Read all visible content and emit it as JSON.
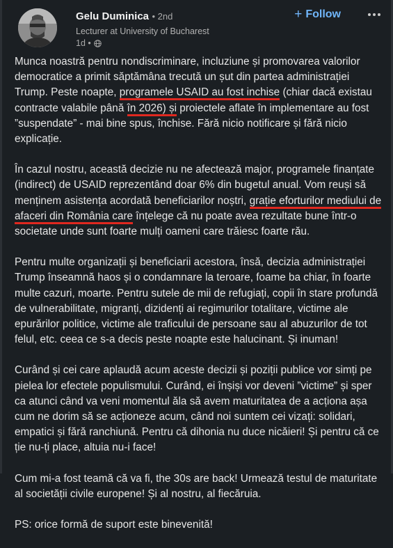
{
  "author": {
    "name": "Gelu Duminica",
    "degree": "• 2nd",
    "headline": "Lecturer at University of Bucharest",
    "time": "1d •"
  },
  "actions": {
    "follow_label": "Follow",
    "follow_plus": "+"
  },
  "colors": {
    "background": "#1b1f23",
    "accent": "#70b5f9",
    "underline": "#e0281f"
  },
  "icons": {
    "visibility": "globe-icon",
    "more": "more-dots-icon"
  },
  "post": {
    "p1": {
      "a": "Munca noastră pentru nondiscriminare, incluziune și promovarea valorilor democratice a primit săptămâna trecută un șut din partea administrației Trump. Peste noapte, ",
      "u1": "programele USAID au fost inchise",
      "b": " (chiar dacă existau contracte valabile până ",
      "u2": "în 2026) și",
      "c": " proiectele aflate în implementare au fost ”suspendate” - mai bine spus, închise. Fără nicio notificare și fără nicio explicație."
    },
    "p2": {
      "a": "În cazul nostru, această decizie nu ne afectează major, programele finanțate (indirect) de USAID reprezentând doar 6% din bugetul anual. Vom reuși să menținem asistența acordată beneficiarilor noștri, ",
      "u1": "grație eforturilor mediului de afaceri din România care",
      "b": " înțelege că nu poate avea rezultate bune într-o societate unde sunt foarte mulți oameni care trăiesc foarte rău."
    },
    "p3": "Pentru multe organizații și beneficiarii acestora, însă, decizia administrației Trump înseamnă haos și o condamnare la teroare, foame ba chiar, în foarte multe cazuri, moarte. Pentru sutele de mii de refugiați, copii în stare profundă de vulnerabilitate, migranți, dizidenți ai regimurilor totalitare, victime ale epurărilor politice, victime ale traficului de persoane sau al abuzurilor de tot felul, etc. ceea ce s-a decis peste noapte este halucinant. Și inuman!",
    "p4": "Curând și cei care aplaudă acum aceste decizii și poziții publice vor simți pe pielea lor efectele populismului. Curând, ei înșiși vor deveni ”victime” și sper ca atunci când va veni momentul ăla să avem maturitatea de a acționa așa cum ne dorim să se acționeze acum, când noi suntem cei vizați: solidari, empatici și fără ranchiună. Pentru că dihonia nu duce nicăieri! Și pentru că ce ție nu-ți place, altuia nu-i face!",
    "p5": "Cum mi-a fost teamă că va fi, the 30s are back! Urmează testul de maturitate al societății civile europene! Și al nostru, al fiecăruia.",
    "p6": "PS: orice formă de suport este binevenită!"
  }
}
